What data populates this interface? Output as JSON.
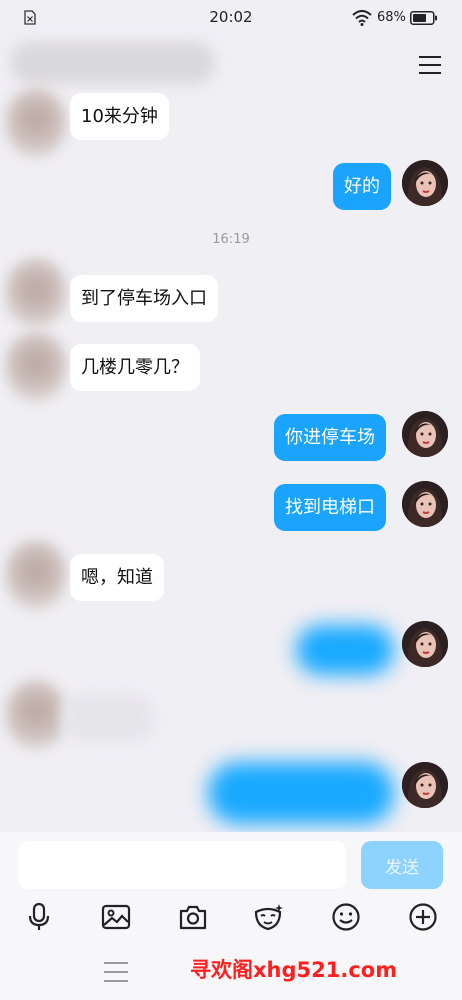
{
  "status_bar": {
    "time": "20:02",
    "battery_percent": "68%"
  },
  "header": {
    "menu_icon": "menu-icon"
  },
  "messages": [
    {
      "direction": "in",
      "text": "10来分钟"
    },
    {
      "direction": "out",
      "text": "好的"
    },
    {
      "type": "timestamp",
      "text": "16:19"
    },
    {
      "direction": "in",
      "text": "到了停车场入口"
    },
    {
      "direction": "in",
      "text": "几楼几零几？"
    },
    {
      "direction": "out",
      "text": "你进停车场"
    },
    {
      "direction": "out",
      "text": "找到电梯口"
    },
    {
      "direction": "in",
      "text": "嗯，知道"
    },
    {
      "direction": "out",
      "text": "",
      "redacted": true
    },
    {
      "direction": "in",
      "text": "",
      "redacted": true
    },
    {
      "direction": "out",
      "text": "",
      "redacted": true
    }
  ],
  "input": {
    "placeholder": "",
    "send_label": "发送"
  },
  "toolbar": [
    "microphone-icon",
    "image-icon",
    "camera-icon",
    "mask-icon",
    "emoji-icon",
    "plus-icon"
  ],
  "watermark": "寻欢阁xhg521.com",
  "colors": {
    "outgoing_bubble": "#1aa3ff",
    "incoming_bubble": "#ffffff",
    "background": "#f0eff4",
    "send_button": "#8ed2ff",
    "watermark": "#ff1f1f"
  }
}
